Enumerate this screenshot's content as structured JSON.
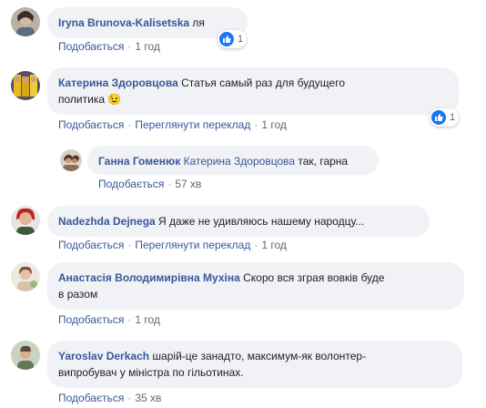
{
  "comments": [
    {
      "author": "Iryna Brunova-Kalisetska",
      "text": "ля",
      "actions": {
        "like": "Подобається",
        "time": "1 год"
      },
      "reactions": {
        "icon": "like-icon",
        "count": "1"
      }
    },
    {
      "author": "Катерина Здоровцова",
      "text_line1": "Статья самый раз для будущего",
      "text_line2": "политика",
      "emoji": "😉",
      "actions": {
        "like": "Подобається",
        "translate": "Переглянути переклад",
        "time": "1 год"
      },
      "reactions": {
        "icon": "like-icon",
        "count": "1"
      }
    },
    {
      "author": "Ганна Гоменюк",
      "mention": "Катерина Здоровцова",
      "text": "так, гарна",
      "actions": {
        "like": "Подобається",
        "time": "57 хв"
      }
    },
    {
      "author": "Nadezhda Dejnega",
      "text": "Я даже не удивляюсь нашему народцу...",
      "actions": {
        "like": "Подобається",
        "translate": "Переглянути переклад",
        "time": "1 год"
      }
    },
    {
      "author": "Анастасія Володимирівна Мухіна",
      "text_line1": "Скоро вся зграя вовків буде",
      "text_line2": "в разом",
      "actions": {
        "like": "Подобається",
        "time": "1 год"
      }
    },
    {
      "author": "Yaroslav Derkach",
      "text_line1": "шарій-це занадто, максимум-як волонтер-",
      "text_line2": "випробувач у міністра по гільотинах.",
      "actions": {
        "like": "Подобається",
        "time": "35 хв"
      }
    }
  ],
  "separator": "·"
}
